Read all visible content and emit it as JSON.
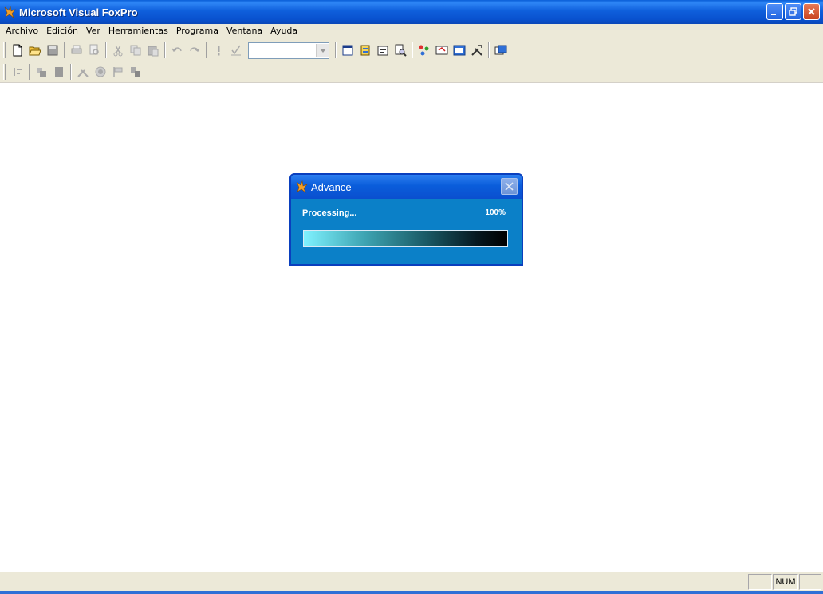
{
  "window": {
    "title": "Microsoft Visual FoxPro",
    "app_icon": "foxpro-icon"
  },
  "menu": {
    "items": [
      {
        "label": "Archivo"
      },
      {
        "label": "Edición"
      },
      {
        "label": "Ver"
      },
      {
        "label": "Herramientas"
      },
      {
        "label": "Programa"
      },
      {
        "label": "Ventana"
      },
      {
        "label": "Ayuda"
      }
    ]
  },
  "toolbar": {
    "combo_value": ""
  },
  "dialog": {
    "title": "Advance",
    "status": "Processing...",
    "percent": "100%",
    "progress": 1.0
  },
  "statusbar": {
    "num": "NUM"
  },
  "colors": {
    "title_blue": "#0a5fd8",
    "dialog_bg": "#0b80c8",
    "chrome": "#ece9d8"
  }
}
